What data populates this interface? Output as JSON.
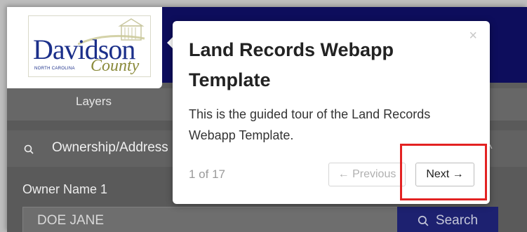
{
  "logo": {
    "word": "Davidson",
    "state": "NORTH CAROLINA",
    "county": "County"
  },
  "tabs": {
    "layers": "Layers"
  },
  "section": {
    "title": "Ownership/Address",
    "caret": "^"
  },
  "form": {
    "owner_label": "Owner Name 1",
    "owner_value": "DOE JANE",
    "search_label": "Search"
  },
  "tour": {
    "title": "Land Records Webapp Template",
    "body": "This is the guided tour of the Land Records Webapp Template.",
    "counter": "1 of 17",
    "previous_label": "← Previous",
    "next_label": "Next →",
    "close_label": "×"
  },
  "colors": {
    "header": "#0d0d5c",
    "highlight": "#e32222",
    "search_button": "#1d2170"
  }
}
